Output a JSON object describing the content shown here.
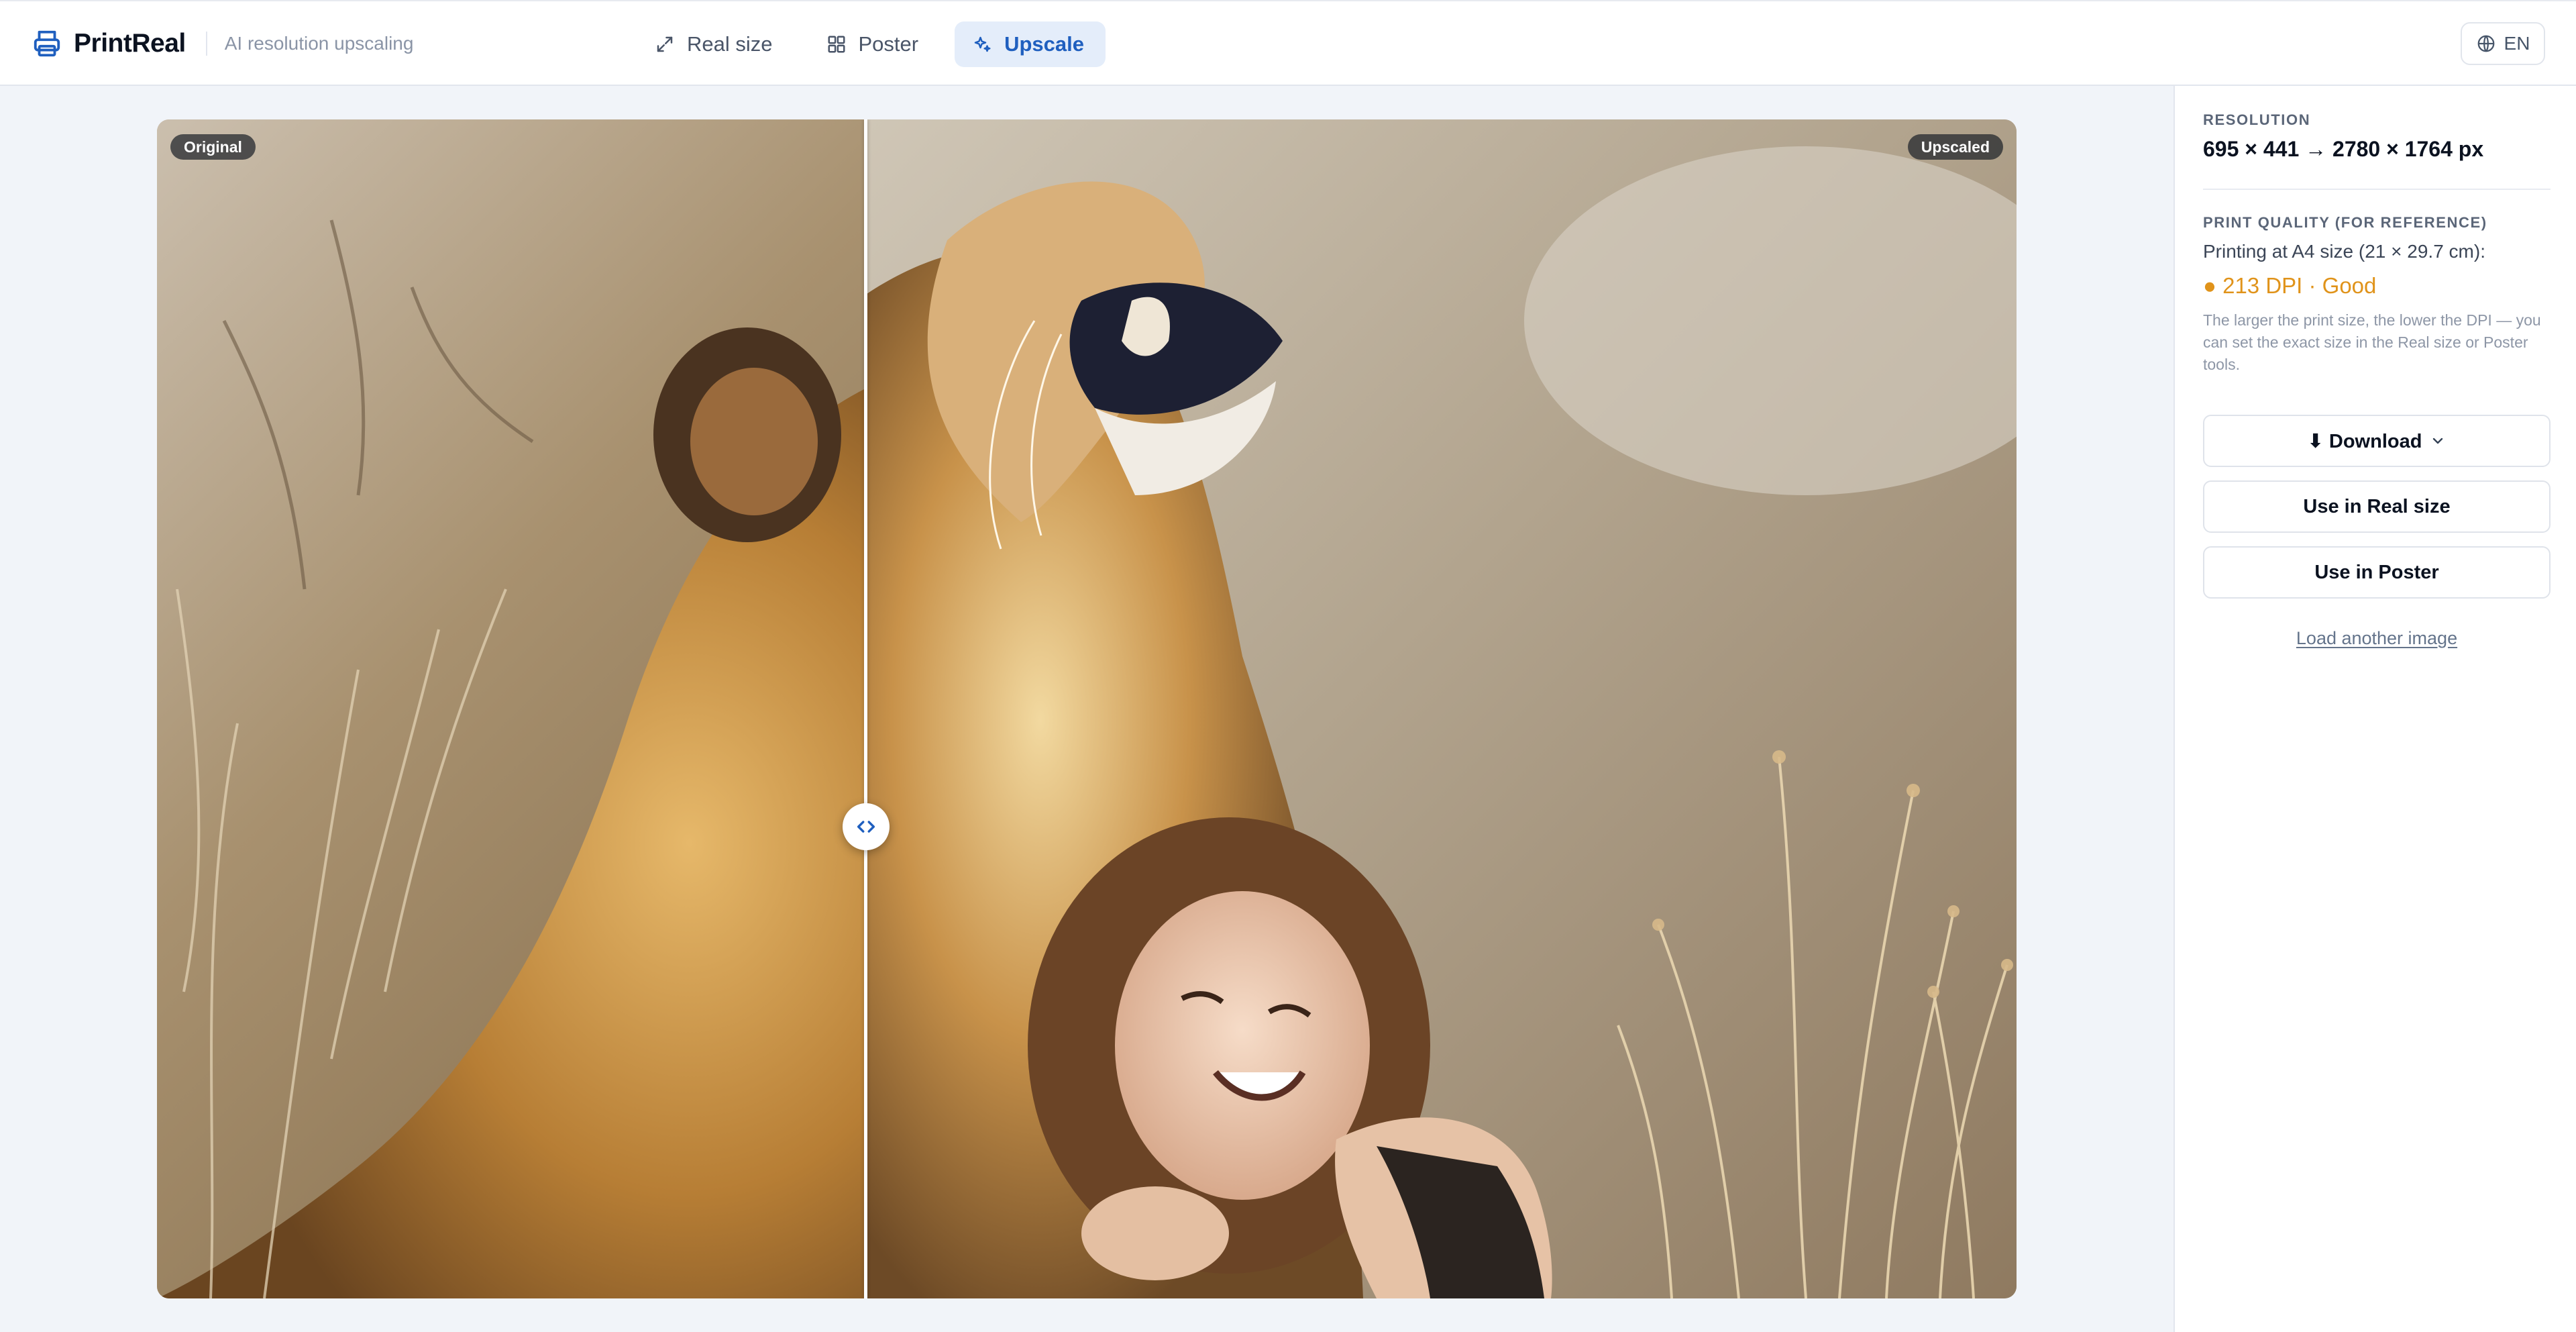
{
  "header": {
    "brand_name": "PrintReal",
    "tagline": "AI resolution upscaling",
    "brand_icon": "printer-icon",
    "tabs": [
      {
        "label": "Real size",
        "icon": "expand-arrows-icon",
        "active": false
      },
      {
        "label": "Poster",
        "icon": "grid-icon",
        "active": false
      },
      {
        "label": "Upscale",
        "icon": "sparkles-icon",
        "active": true
      }
    ],
    "language": {
      "label": "EN",
      "icon": "globe-icon"
    }
  },
  "viewer": {
    "left_badge": "Original",
    "right_badge": "Upscaled",
    "handle_icon": "chevrons-left-right-icon",
    "split_fraction": 0.381
  },
  "sidebar": {
    "resolution_label": "RESOLUTION",
    "resolution_value": "695 × 441 → 2780 × 1764 px",
    "print_quality_label": "PRINT QUALITY (FOR REFERENCE)",
    "print_size_text": "Printing at A4 size (21 × 29.7 cm):",
    "dpi_text": "● 213 DPI · Good",
    "note": "The larger the print size, the lower the DPI — you can set the exact size in the Real size or Poster tools.",
    "download_label": "⬇ Download",
    "use_real_size_label": "Use in Real size",
    "use_poster_label": "Use in Poster",
    "load_another_label": "Load another image"
  },
  "colors": {
    "accent": "#1f5fbf",
    "accent_bg": "#e4edfa",
    "dpi_good": "#e0931a",
    "page_bg": "#f1f4f9"
  }
}
